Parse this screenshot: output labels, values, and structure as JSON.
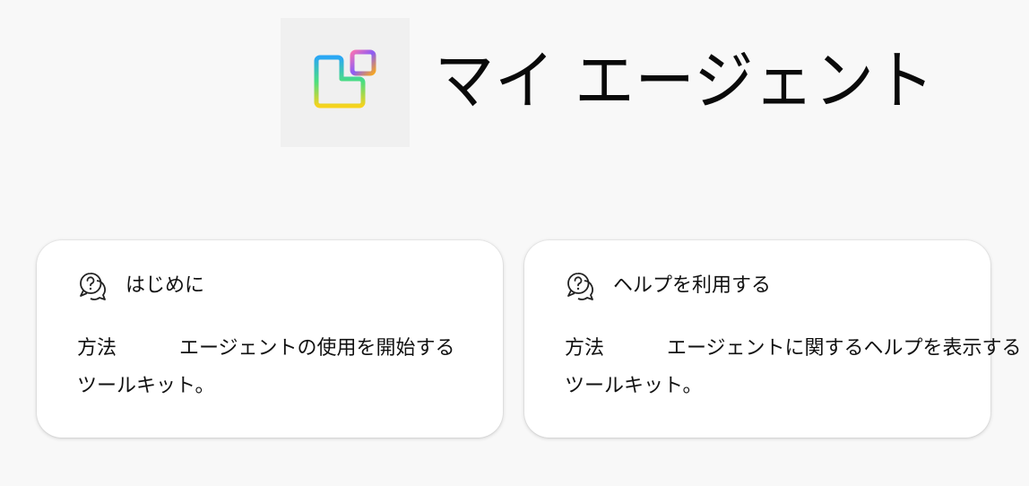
{
  "header": {
    "title": "マイ エージェント",
    "icon": "apps-grid-icon",
    "icon_colors": [
      "#2aa7f5",
      "#8b5cf6",
      "#f472b6",
      "#f5a623",
      "#f7d31d",
      "#4ade80"
    ]
  },
  "cards": [
    {
      "icon": "help-chat-icon",
      "title": "はじめに",
      "method_label": "方法",
      "desc_line1": "エージェントの使用を開始する",
      "desc_line2": "ツールキット。"
    },
    {
      "icon": "help-chat-icon",
      "title": "ヘルプを利用する",
      "method_label": "方法",
      "desc_line1": "エージェントに関するヘルプを表示する",
      "desc_line2": "ツールキット。"
    }
  ]
}
